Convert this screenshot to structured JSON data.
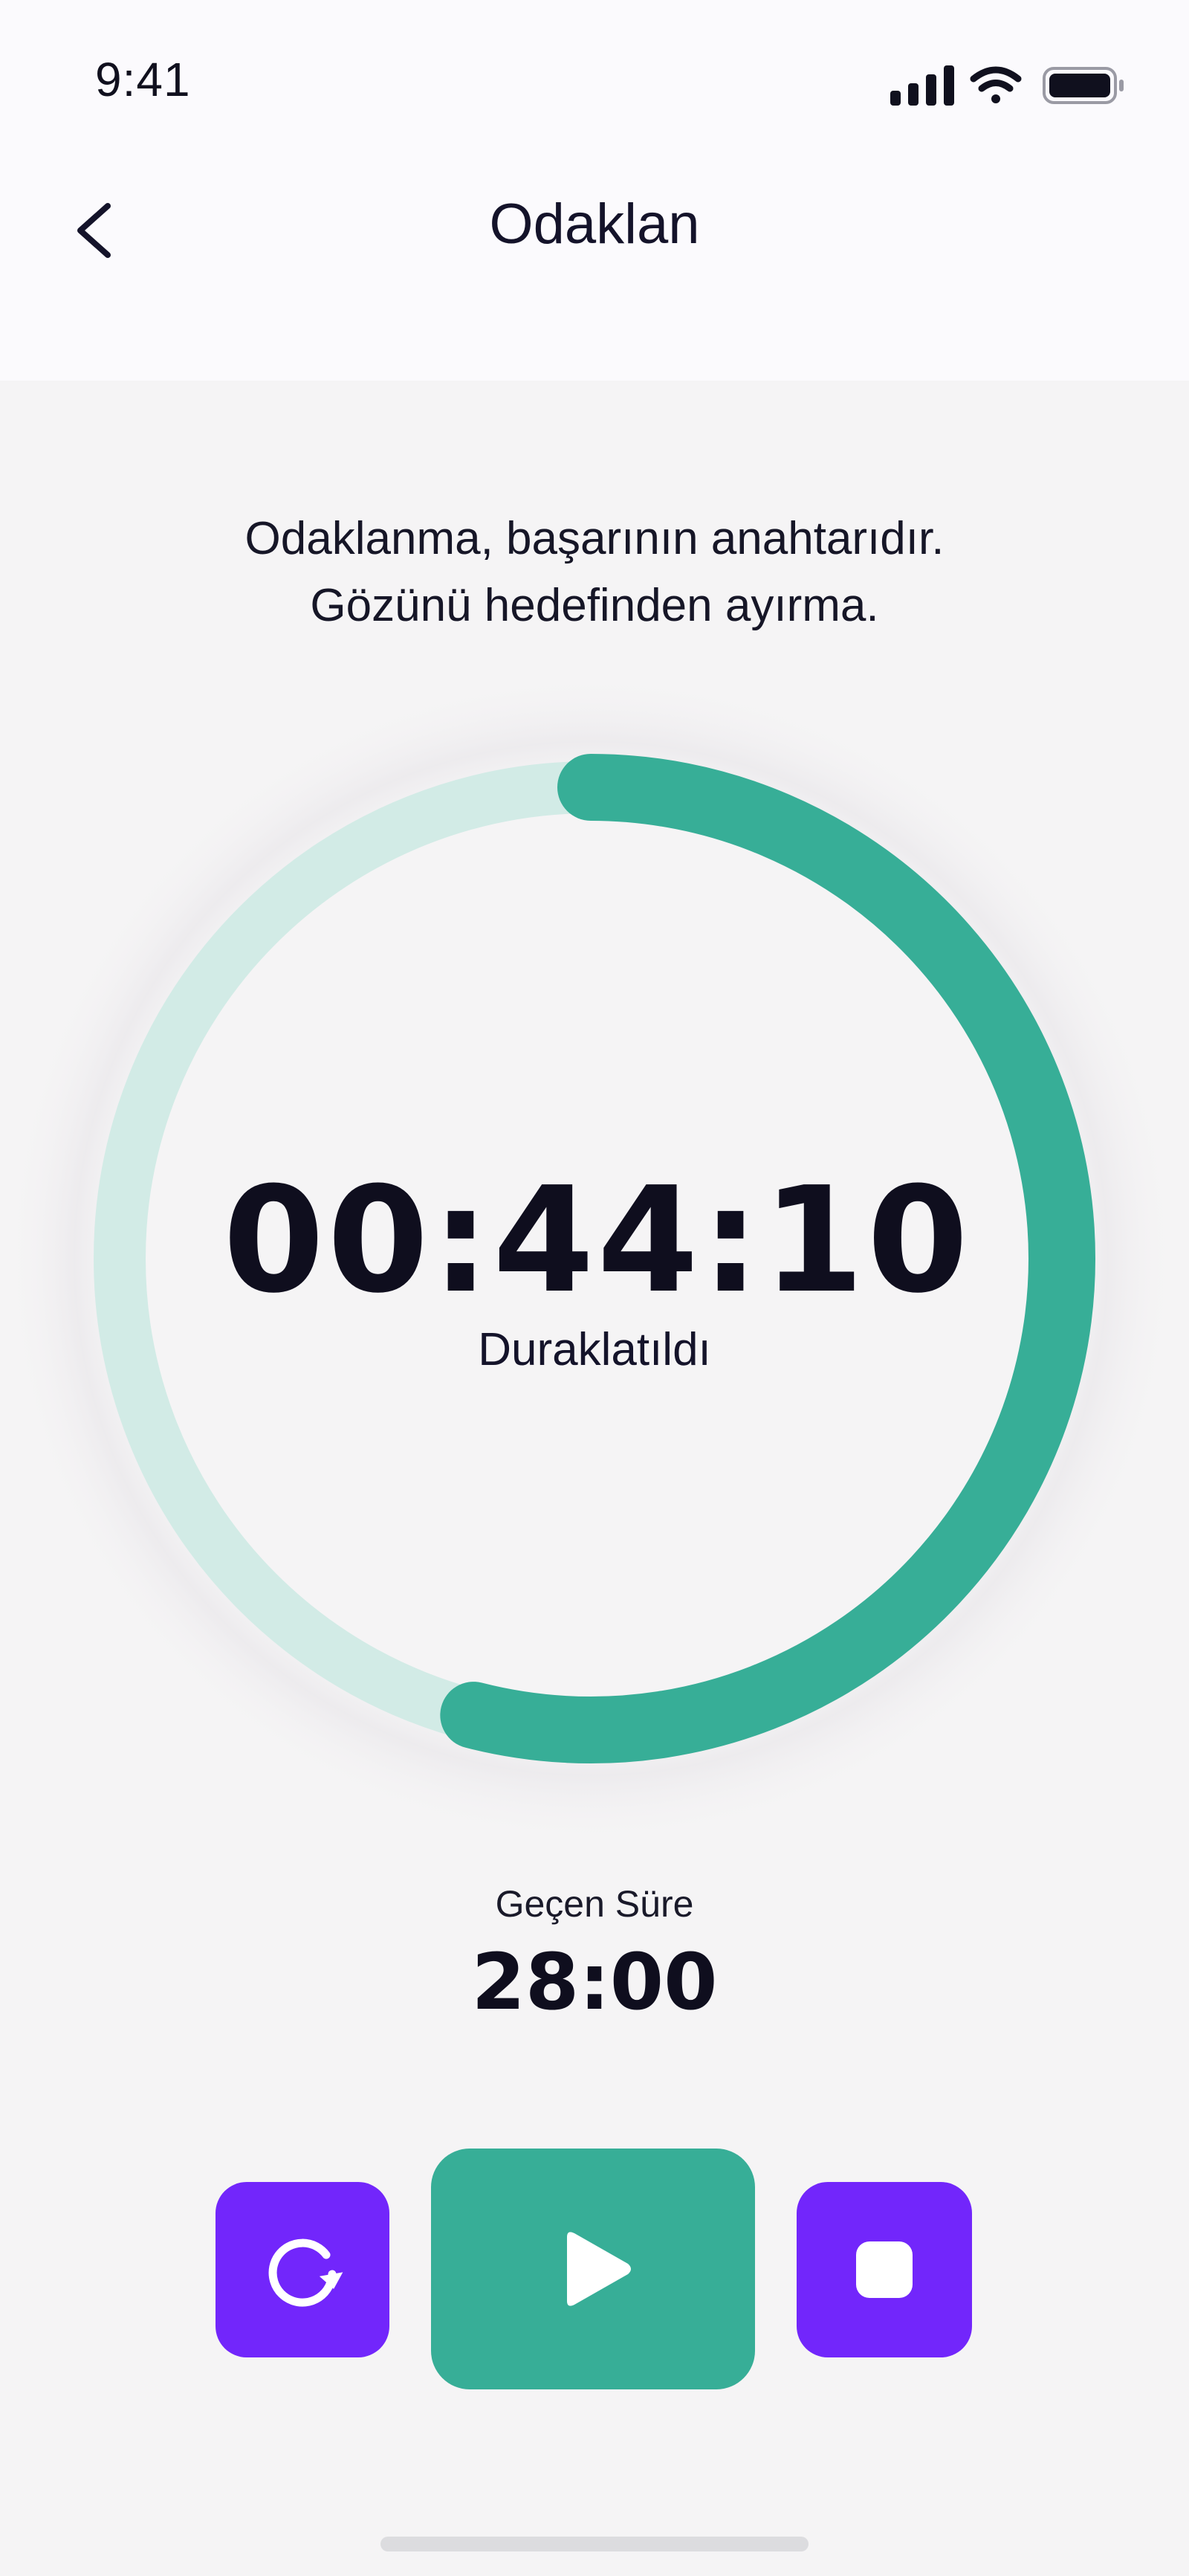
{
  "status_bar": {
    "time": "9:41",
    "icons": [
      "signal-icon",
      "wifi-icon",
      "battery-icon"
    ]
  },
  "header": {
    "back_icon": "chevron-left-icon",
    "title": "Odaklan"
  },
  "quote": {
    "line1": "Odaklanma, başarının anahtarıdır.",
    "line2": "Gözünü hedefinden ayırma."
  },
  "timer": {
    "remaining": "00:44:10",
    "state": "Duraklatıldı",
    "progress_fraction": 0.54
  },
  "elapsed": {
    "label": "Geçen Süre",
    "value": "28:00"
  },
  "controls": {
    "reset_icon": "restart-icon",
    "play_icon": "play-icon",
    "stop_icon": "stop-icon"
  },
  "colors": {
    "accent_green": "#37ae97",
    "track_green": "#d2ebe6",
    "accent_purple": "#7226fb",
    "text_dark": "#0f0e1e",
    "header_bg": "#fbfafd",
    "page_bg": "#f5f4f5"
  }
}
